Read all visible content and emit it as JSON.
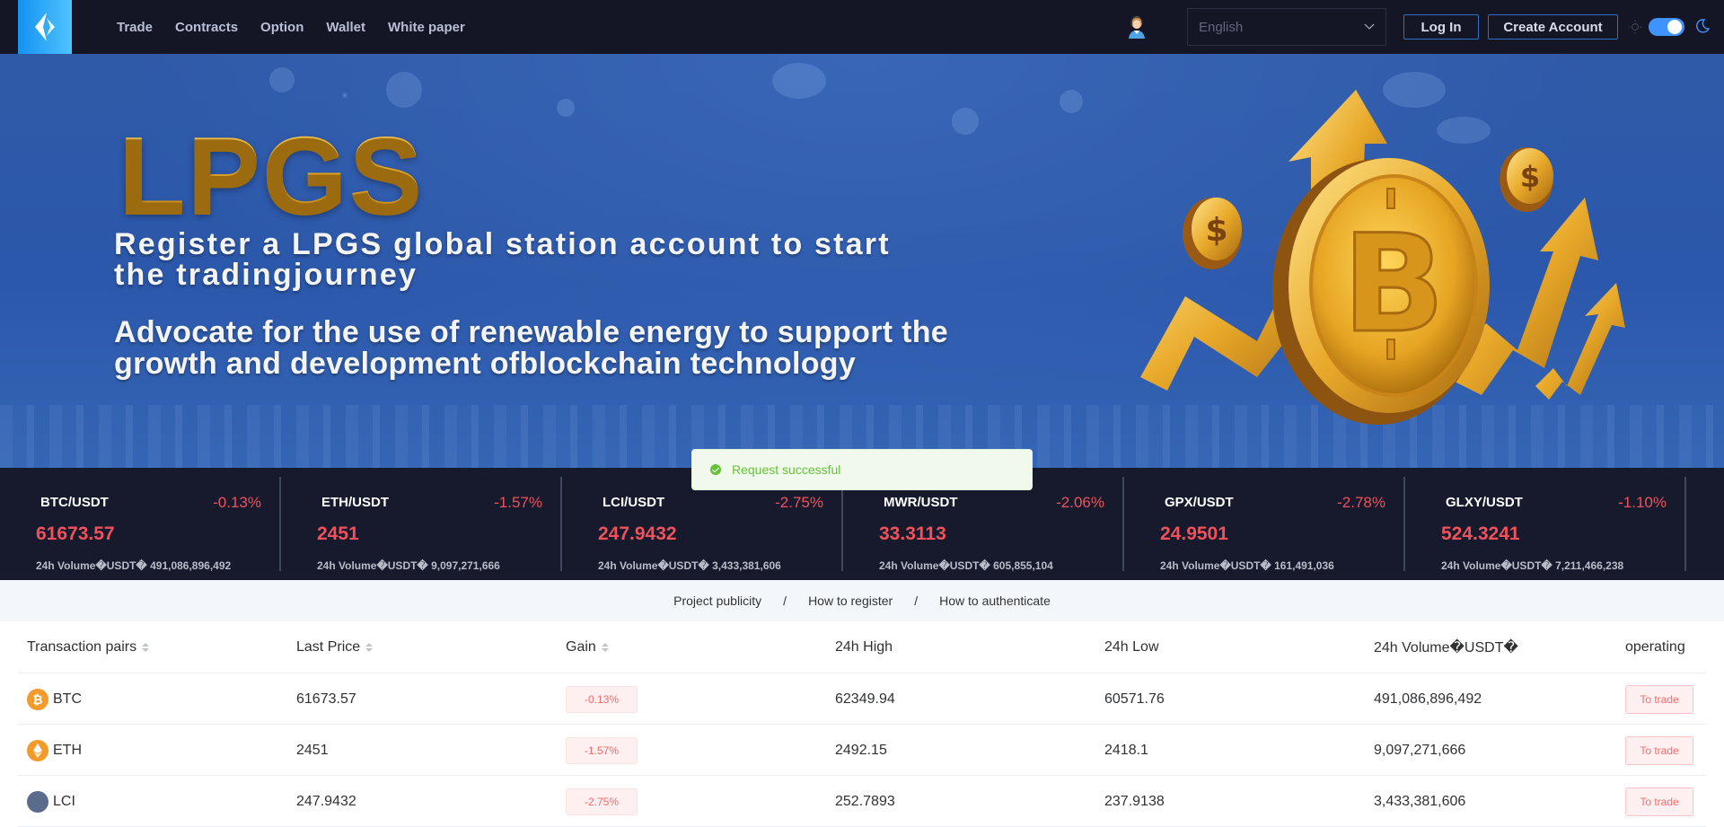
{
  "nav": {
    "links": [
      "Trade",
      "Contracts",
      "Option",
      "Wallet",
      "White paper"
    ],
    "language": "English",
    "login_label": "Log In",
    "create_account_label": "Create Account",
    "theme": "dark",
    "icons": {
      "logo": "brand-diamond-logo",
      "support": "customer-support-agent",
      "sun": "sun-icon",
      "moon": "moon-icon",
      "chevron": "chevron-down-icon"
    }
  },
  "banner": {
    "title": "LPGS",
    "line1": "Register a LPGS global station account to start the tradingjourney",
    "line2": "Advocate for the use of renewable energy to support the growth and development ofblockchain technology",
    "art": "gold-bitcoin-coin-with-rising-arrows"
  },
  "ticker": [
    {
      "pair": "BTC/USDT",
      "change": "-0.13%",
      "price": "61673.57",
      "volume_label": "24h Volume�USDT�",
      "volume": "491,086,896,492"
    },
    {
      "pair": "ETH/USDT",
      "change": "-1.57%",
      "price": "2451",
      "volume_label": "24h Volume�USDT�",
      "volume": "9,097,271,666"
    },
    {
      "pair": "LCI/USDT",
      "change": "-2.75%",
      "price": "247.9432",
      "volume_label": "24h Volume�USDT�",
      "volume": "3,433,381,606"
    },
    {
      "pair": "MWR/USDT",
      "change": "-2.06%",
      "price": "33.3113",
      "volume_label": "24h Volume�USDT�",
      "volume": "605,855,104"
    },
    {
      "pair": "GPX/USDT",
      "change": "-2.78%",
      "price": "24.9501",
      "volume_label": "24h Volume�USDT�",
      "volume": "161,491,036"
    },
    {
      "pair": "GLXY/USDT",
      "change": "-1.10%",
      "price": "524.3241",
      "volume_label": "24h Volume�USDT�",
      "volume": "7,211,466,238"
    }
  ],
  "toast": {
    "message": "Request successful",
    "type": "success"
  },
  "subnav": {
    "links": [
      "Project publicity",
      "How to register",
      "How to authenticate"
    ],
    "separator": "/"
  },
  "table": {
    "headers": [
      "Transaction pairs",
      "Last Price",
      "Gain",
      "24h High",
      "24h Low",
      "24h Volume�USDT�",
      "operating"
    ],
    "sortable": [
      true,
      true,
      true,
      false,
      false,
      false,
      false
    ],
    "rows": [
      {
        "icon": "bitcoin-icon",
        "glyph": "₿",
        "pair": "BTC",
        "last": "61673.57",
        "gain": "-0.13%",
        "high": "62349.94",
        "low": "60571.76",
        "volume": "491,086,896,492",
        "action": "To trade"
      },
      {
        "icon": "ethereum-icon",
        "glyph": "◆",
        "pair": "ETH",
        "last": "2451",
        "gain": "-1.57%",
        "high": "2492.15",
        "low": "2418.1",
        "volume": "9,097,271,666",
        "action": "To trade"
      },
      {
        "icon": "lci-coin-icon",
        "glyph": "",
        "pair": "LCI",
        "last": "247.9432",
        "gain": "-2.75%",
        "high": "252.7893",
        "low": "237.9138",
        "volume": "3,433,381,606",
        "action": "To trade"
      }
    ]
  },
  "colors": {
    "navbar_bg": "#141626",
    "ticker_bg": "#161a2c",
    "down_red": "#f0515b",
    "accent_blue": "#3f93ff",
    "success_green": "#67c23a"
  }
}
